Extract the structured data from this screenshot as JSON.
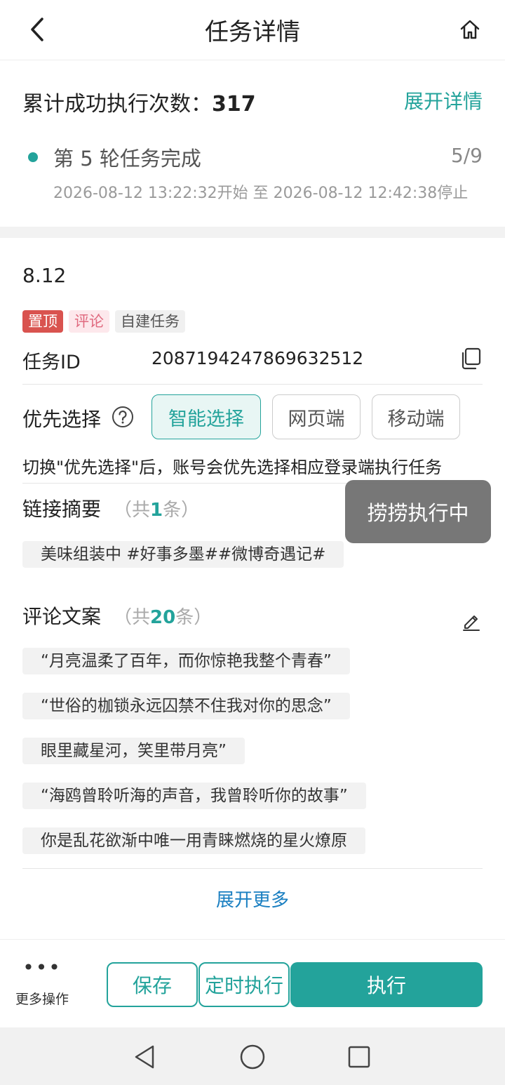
{
  "header": {
    "title": "任务详情",
    "back_icon": "chevron-left-icon",
    "home_icon": "home-icon"
  },
  "summary": {
    "label": "累计成功执行次数：",
    "count": "317",
    "expand_label": "展开详情",
    "round_title": "第 5 轮任务完成",
    "round_progress": "5/9",
    "round_time": "2026-08-12 13:22:32开始 至 2026-08-12 12:42:38停止"
  },
  "task": {
    "name": "8.12",
    "tags": {
      "pin": "置顶",
      "comment": "评论",
      "self_built": "自建任务"
    },
    "id_label": "任务ID",
    "id_value": "2087194247869632512"
  },
  "preference": {
    "label": "优先选择",
    "options": {
      "smart": "智能选择",
      "web": "网页端",
      "mobile": "移动端"
    },
    "selected": "智能选择",
    "hint": "切换\"优先选择\"后，账号会优先选择相应登录端执行任务"
  },
  "links": {
    "title": "链接摘要",
    "count_prefix": "（共",
    "count": "1",
    "count_suffix": "条）",
    "items": [
      "美味组装中 #好事多墨##微博奇遇记#"
    ]
  },
  "comments": {
    "title": "评论文案",
    "count_prefix": "（共",
    "count": "20",
    "count_suffix": "条）",
    "items": [
      "“月亮温柔了百年，而你惊艳我整个青春”",
      "“世俗的枷锁永远囚禁不住我对你的思念”",
      "眼里藏星河，笑里带月亮”",
      "“海鸥曾聆听海的声音，我曾聆听你的故事”",
      "你是乱花欲渐中唯一用青睐燃烧的星火燎原"
    ],
    "expand_more": "展开更多"
  },
  "toast": {
    "text": "捞捞执行中"
  },
  "bottom_bar": {
    "more_ops": "更多操作",
    "save": "保存",
    "timer": "定时执行",
    "execute": "执行"
  },
  "colors": {
    "accent": "#23a39b",
    "link": "#1a7fc1",
    "pin_tag": "#d9534f"
  }
}
